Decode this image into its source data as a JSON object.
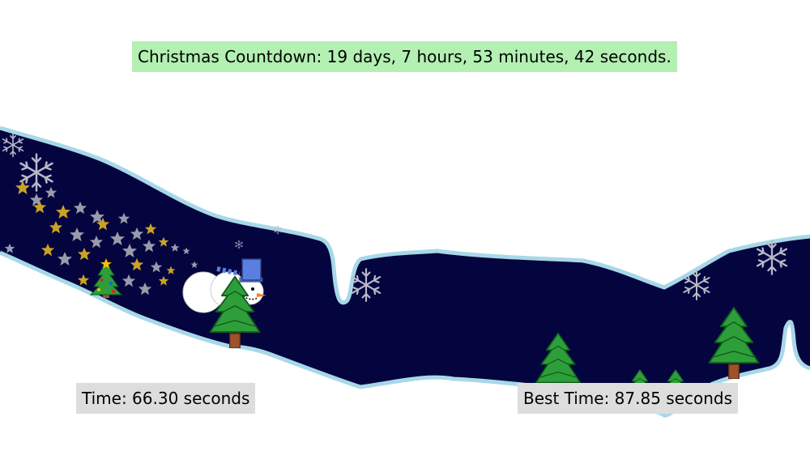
{
  "countdown": {
    "text": "Christmas Countdown: 19 days, 7 hours, 53 minutes, 42 seconds.",
    "days": 19,
    "hours": 7,
    "minutes": 53,
    "seconds": 42
  },
  "run_time": {
    "text": "Time: 66.30 seconds",
    "seconds": 66.3
  },
  "best_time": {
    "text": "Best Time: 87.85 seconds",
    "seconds": 87.85
  },
  "colors": {
    "night_sky": "#04043f",
    "snow_edge": "#a8d8e8",
    "countdown_bg": "#b3f0b2",
    "hud_bg": "#dddddd",
    "tree_green": "#2e9e3a",
    "tree_trunk": "#a0522d",
    "star_gold": "#c9a227",
    "star_silver": "#9a9aab",
    "hat_blue": "#5a7fe0"
  },
  "icons": {
    "player": "snowman-icon",
    "obstacle": "pine-tree-icon",
    "decoration": "snowflake-icon",
    "trail": "star-icon",
    "bonus": "christmas-tree-icon"
  }
}
